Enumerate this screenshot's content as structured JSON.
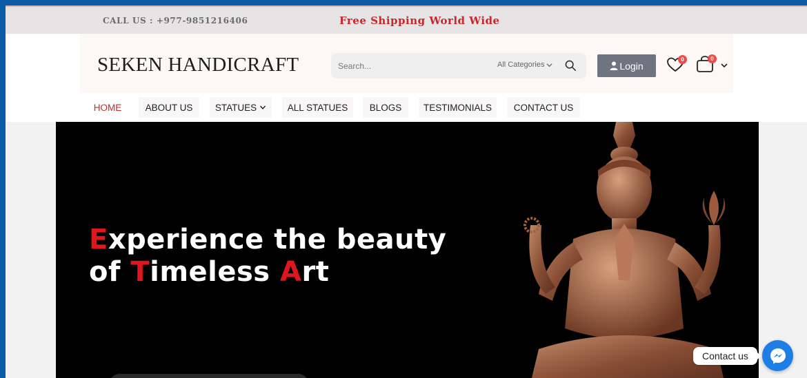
{
  "topbar": {
    "call": "CALL US : +977-9851216406",
    "shipping": "Free Shipping World Wide"
  },
  "header": {
    "logo": "SEKEN HANDICRAFT",
    "search": {
      "placeholder": "Search...",
      "category": "All Categories"
    },
    "login_label": "Login",
    "wishlist_count": "0",
    "cart_count": "0"
  },
  "nav": {
    "items": [
      {
        "label": "HOME"
      },
      {
        "label": "ABOUT US"
      },
      {
        "label": "STATUES"
      },
      {
        "label": "ALL STATUES"
      },
      {
        "label": "BLOGS"
      },
      {
        "label": "TESTIMONIALS"
      },
      {
        "label": "CONTACT US"
      }
    ]
  },
  "hero": {
    "line1_first": "E",
    "line1_rest": "xperience the beauty",
    "line2_a": "of ",
    "line2_b": "T",
    "line2_c": "imeless ",
    "line2_d": "A",
    "line2_e": "rt"
  },
  "contact": {
    "label": "Contact us"
  },
  "colors": {
    "accent": "#c9262a",
    "messenger": "#1e7ee6",
    "login_bg": "#6e7580"
  },
  "icons": [
    "search-icon",
    "user-icon",
    "heart-icon",
    "cart-icon",
    "chevron-down-icon",
    "messenger-icon"
  ]
}
